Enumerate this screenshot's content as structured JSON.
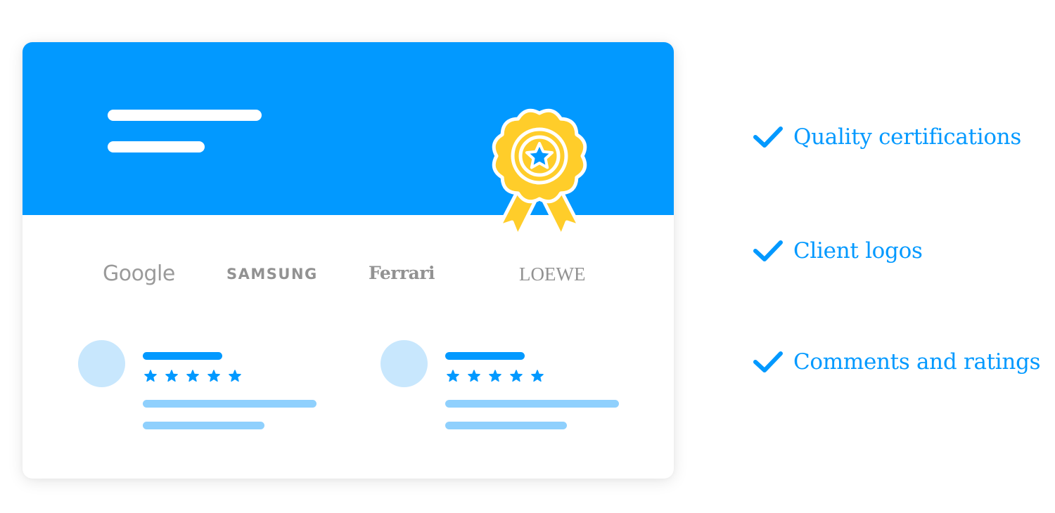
{
  "colors": {
    "brand_blue": "#0299ff",
    "badge_yellow": "#ffcd2a",
    "avatar_bg": "#c8e7fd",
    "text_line": "#8fd0fd",
    "logo_gray": "#929292"
  },
  "card": {
    "header": {
      "placeholder_lines": 2,
      "badge_icon": "award-rosette-star-icon"
    },
    "client_logos": [
      {
        "name": "Google"
      },
      {
        "name": "SAMSUNG"
      },
      {
        "name": "Ferrari"
      },
      {
        "name": "LOEWE"
      }
    ],
    "reviews": [
      {
        "avatar": "avatar-placeholder",
        "rating": 5,
        "max_rating": 5
      },
      {
        "avatar": "avatar-placeholder",
        "rating": 5,
        "max_rating": 5
      }
    ]
  },
  "features": [
    {
      "icon": "checkmark-icon",
      "label": "Quality certifications"
    },
    {
      "icon": "checkmark-icon",
      "label": "Client logos"
    },
    {
      "icon": "checkmark-icon",
      "label": "Comments and ratings"
    }
  ]
}
